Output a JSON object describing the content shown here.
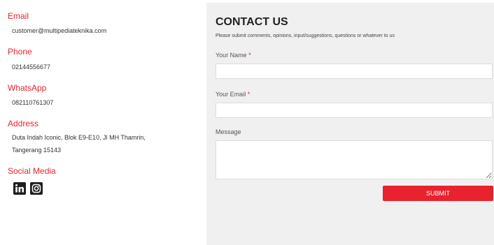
{
  "contact_info": {
    "email": {
      "label": "Email",
      "value": "customer@multipediateknika.com"
    },
    "phone": {
      "label": "Phone",
      "value": "02144556677"
    },
    "whatsapp": {
      "label": "WhatsApp",
      "value": "082110761307"
    },
    "address": {
      "label": "Address",
      "line1": "Duta Indah Iconic, Blok E9-E10, Jl MH Thamrin,",
      "line2": "Tangerang 15143"
    },
    "social": {
      "label": "Social Media",
      "icons": [
        "linkedin-icon",
        "instagram-icon"
      ]
    }
  },
  "contact_form": {
    "title": "CONTACT US",
    "subtitle": "Please submit comments, opinions, input/suggestions, questions or whatever to us",
    "name_label": "Your Name",
    "email_label": "Your Email",
    "required_mark": "*",
    "message_label": "Message",
    "name_value": "",
    "email_value": "",
    "message_value": "",
    "submit_label": "SUBMIT"
  },
  "colors": {
    "accent": "#e8232e",
    "panel_bg": "#f0f0f0",
    "icon_bg": "#1f1f1f"
  }
}
